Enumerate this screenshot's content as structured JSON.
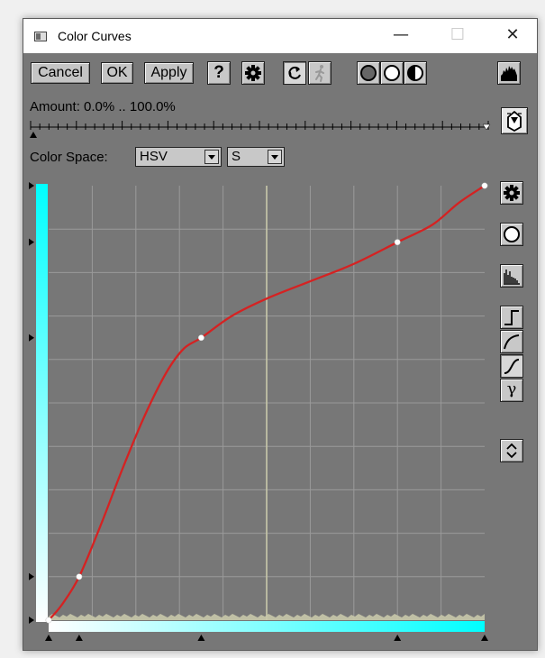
{
  "window": {
    "title": "Color Curves",
    "minimize_glyph": "—",
    "maximize_glyph": "☐",
    "close_glyph": "✕"
  },
  "toolbar": {
    "cancel_label": "Cancel",
    "ok_label": "OK",
    "apply_label": "Apply",
    "help_label": "?",
    "icons": [
      "gear-icon",
      "refresh-icon",
      "run-icon",
      "circle-mode-icon",
      "circle-mode-icon",
      "half-circle-icon",
      "histogram-icon"
    ]
  },
  "amount": {
    "label": "Amount: 0.0% .. 100.0%",
    "min_percent": 0.0,
    "max_percent": 100.0
  },
  "color_space": {
    "label": "Color Space:",
    "space_value": "HSV",
    "channel_value": "S"
  },
  "side_panel": {
    "gamma_label": "γ",
    "icons": [
      "gear-icon",
      "circle-icon",
      "histogram-icon",
      "step-curve-icon",
      "log-curve-icon",
      "s-curve-icon",
      "gamma-icon",
      "spinner-icon"
    ]
  },
  "colors": {
    "curve": "#d52222",
    "gradient_end": "#00ffff",
    "gradient_start": "#ffffff",
    "plot_background": "#777777",
    "grid": "#9a9a9a",
    "histogram": "#c8c8aa"
  },
  "chart_data": {
    "type": "line",
    "title": "",
    "xlabel": "",
    "ylabel": "",
    "xlim": [
      0,
      1
    ],
    "ylim": [
      0,
      1
    ],
    "grid": true,
    "grid_divisions": 10,
    "control_points": [
      {
        "x": 0.0,
        "y": 0.0
      },
      {
        "x": 0.07,
        "y": 0.1
      },
      {
        "x": 0.35,
        "y": 0.65
      },
      {
        "x": 0.8,
        "y": 0.87
      },
      {
        "x": 1.0,
        "y": 1.0
      }
    ],
    "curve": [
      [
        0.0,
        0.0
      ],
      [
        0.03,
        0.035
      ],
      [
        0.07,
        0.1
      ],
      [
        0.12,
        0.22
      ],
      [
        0.17,
        0.35
      ],
      [
        0.22,
        0.47
      ],
      [
        0.27,
        0.57
      ],
      [
        0.31,
        0.625
      ],
      [
        0.35,
        0.65
      ],
      [
        0.42,
        0.7
      ],
      [
        0.5,
        0.74
      ],
      [
        0.6,
        0.78
      ],
      [
        0.7,
        0.82
      ],
      [
        0.8,
        0.87
      ],
      [
        0.88,
        0.91
      ],
      [
        0.94,
        0.96
      ],
      [
        1.0,
        1.0
      ]
    ],
    "histogram_spike_x": 0.5
  }
}
